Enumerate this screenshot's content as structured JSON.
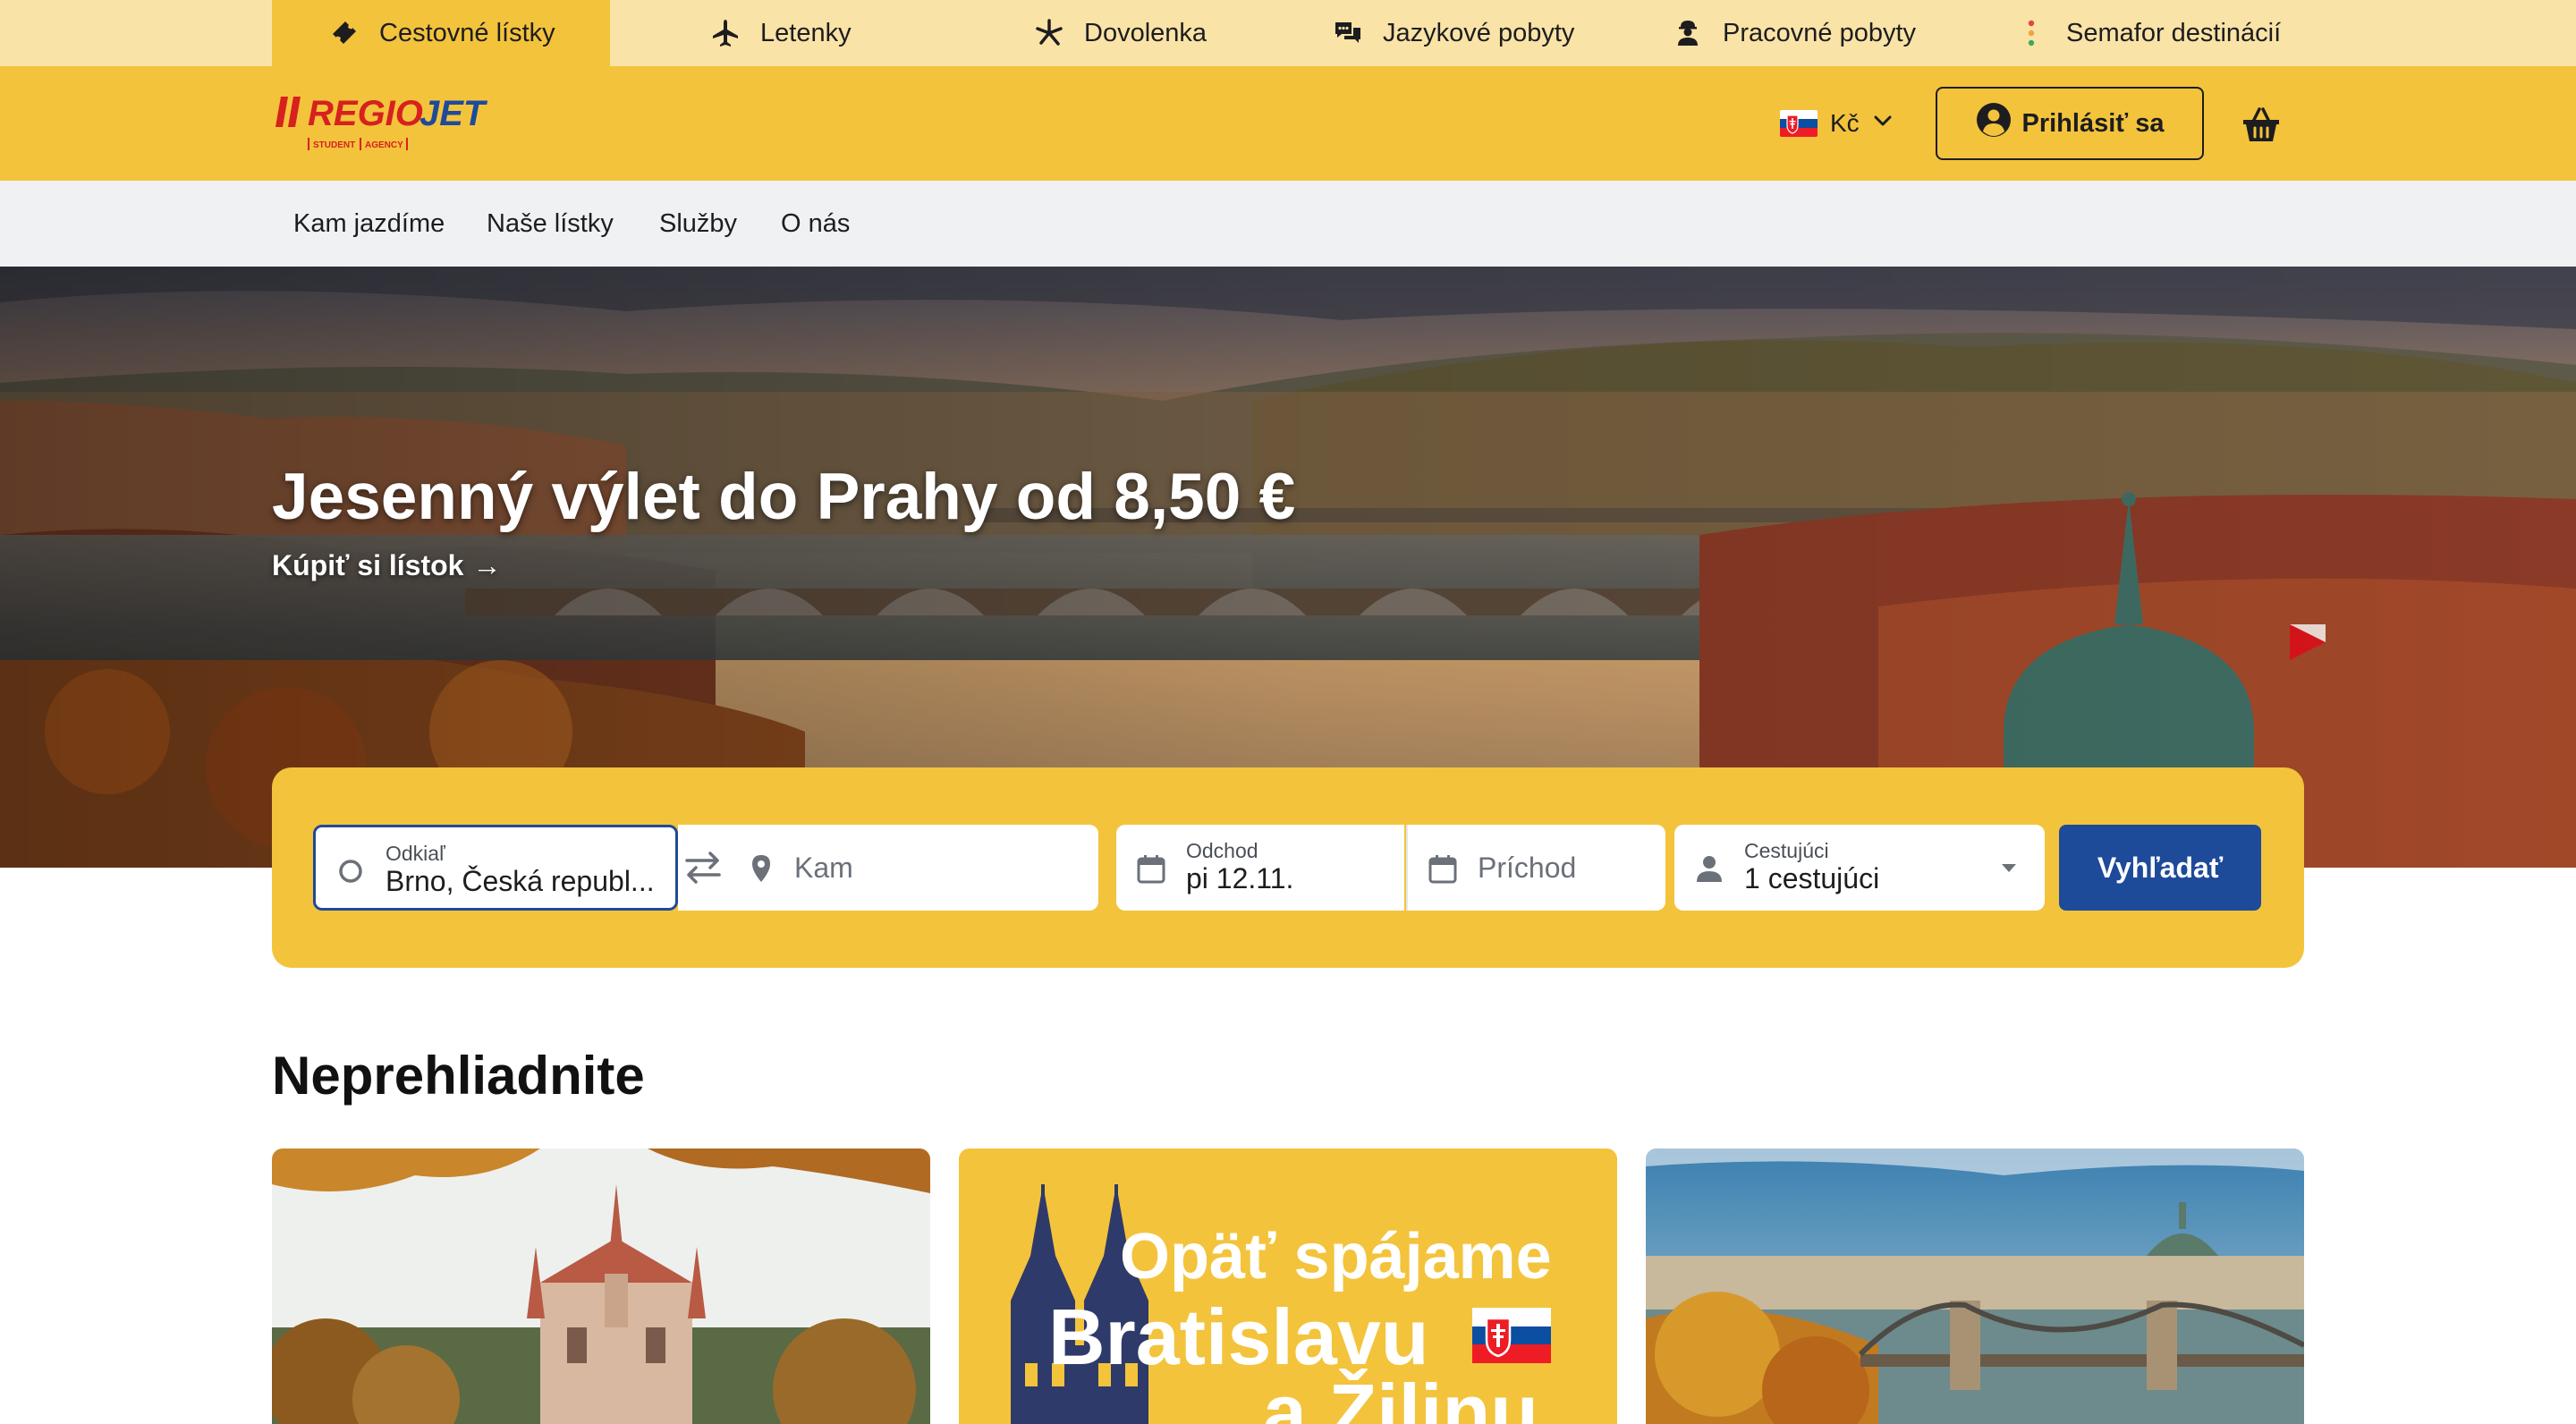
{
  "topbar": {
    "items": [
      {
        "label": "Cestovné lístky",
        "icon": "ticket-icon",
        "active": true
      },
      {
        "label": "Letenky",
        "icon": "airplane-icon",
        "active": false
      },
      {
        "label": "Dovolenka",
        "icon": "palm-tree-icon",
        "active": false
      },
      {
        "label": "Jazykové pobyty",
        "icon": "chat-bubbles-icon",
        "active": false
      },
      {
        "label": "Pracovné pobyty",
        "icon": "worker-icon",
        "active": false
      },
      {
        "label": "Semafor destinácií",
        "icon": "traffic-light-icon",
        "active": false
      }
    ]
  },
  "header": {
    "logo_text": "REGIOJET",
    "logo_sub": "STUDENT | AGENCY",
    "currency": "Kč",
    "flag": "slovakia-flag-icon",
    "login_label": "Prihlásiť sa",
    "cart_icon": "shopping-basket-icon"
  },
  "subnav": {
    "items": [
      "Kam jazdíme",
      "Naše lístky",
      "Služby",
      "O nás"
    ]
  },
  "hero": {
    "title": "Jesenný výlet do Prahy od 8,50 €",
    "cta": "Kúpiť si lístok",
    "cta_arrow": "→"
  },
  "search": {
    "from_label": "Odkiaľ",
    "from_value": "Brno, Česká republ...",
    "to_placeholder": "Kam",
    "departure_label": "Odchod",
    "departure_value": "pi 12.11.",
    "return_placeholder": "Príchod",
    "passengers_label": "Cestujúci",
    "passengers_value": "1 cestujúci",
    "button_label": "Vyhľadať"
  },
  "section": {
    "title": "Neprehliadnite"
  },
  "promo": {
    "line1": "Opäť spájame",
    "line2": "Bratislavu",
    "line3": "a Žilinu"
  },
  "colors": {
    "brand_yellow": "#f3c33c",
    "strip_yellow": "#fae3a6",
    "brand_blue": "#1e4a9a",
    "logo_red": "#d6211e",
    "logo_blue": "#1e4a9a"
  }
}
